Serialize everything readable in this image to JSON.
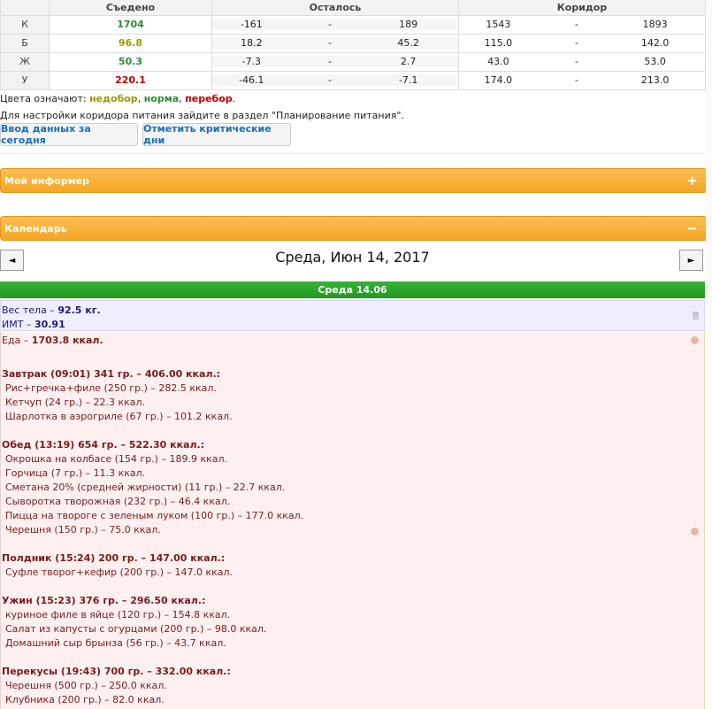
{
  "summary": {
    "headers": {
      "key": "",
      "eaten": "Съедено",
      "remaining": "Осталось",
      "corridor": "Коридор"
    },
    "rows": [
      {
        "key": "К",
        "eaten": "1704",
        "eaten_color": "#2e8b2e",
        "rem_from": "-161",
        "sep": "-",
        "rem_to": "189",
        "cor_from": "1543",
        "cor_sep": "-",
        "cor_to": "1893"
      },
      {
        "key": "Б",
        "eaten": "96.8",
        "eaten_color": "#9a9a00",
        "rem_from": "18.2",
        "sep": "-",
        "rem_to": "45.2",
        "cor_from": "115.0",
        "cor_sep": "-",
        "cor_to": "142.0"
      },
      {
        "key": "Ж",
        "eaten": "50.3",
        "eaten_color": "#2e8b2e",
        "rem_from": "-7.3",
        "sep": "-",
        "rem_to": "2.7",
        "cor_from": "43.0",
        "cor_sep": "-",
        "cor_to": "53.0"
      },
      {
        "key": "У",
        "eaten": "220.1",
        "eaten_color": "#c00000",
        "rem_from": "-46.1",
        "sep": "-",
        "rem_to": "-7.1",
        "cor_from": "174.0",
        "cor_sep": "-",
        "cor_to": "213.0"
      }
    ]
  },
  "legend": {
    "prefix": "Цвета означают: ",
    "under": "недобор",
    "comma1": ", ",
    "norm": "норма",
    "comma2": ", ",
    "over": "перебор",
    "end": "."
  },
  "hint": "Для настройки коридора питания зайдите в раздел \"Планирование питания\".",
  "buttons": {
    "today": "Ввод данных за сегодня",
    "critical": "Отметить критические дни"
  },
  "informer": {
    "title": "Мой информер",
    "toggle": "+"
  },
  "calendar": {
    "title": "Календарь",
    "toggle": "−",
    "prev": "◄",
    "next": "►",
    "date": "Среда, Июн 14, 2017",
    "day_label": "Среда 14.06"
  },
  "body": {
    "weight_label": "Вес тела – ",
    "weight_value": "92.5 кг.",
    "bmi_label": "ИМТ – ",
    "bmi_value": "30.91"
  },
  "food": {
    "total_label": "Еда – ",
    "total_value": "1703.8 ккал.",
    "lines": [
      {
        "type": "meal",
        "text": "Завтрак (09:01) 341 гр. – 406.00 ккал.:"
      },
      {
        "type": "item",
        "text": "Рис+гречка+филе (250 гр.) – 282.5 ккал."
      },
      {
        "type": "item",
        "text": "Кетчуп (24 гр.) – 22.3 ккал."
      },
      {
        "type": "item",
        "text": "Шарлотка в аэрогриле (67 гр.) – 101.2 ккал."
      },
      {
        "type": "meal",
        "text": "Обед (13:19) 654 гр. – 522.30 ккал.:"
      },
      {
        "type": "item",
        "text": "Окрошка на колбасе (154 гр.) – 189.9 ккал."
      },
      {
        "type": "item",
        "text": "Горчица (7 гр.) – 11.3 ккал."
      },
      {
        "type": "item",
        "text": "Сметана 20% (средней жирности) (11 гр.) – 22.7 ккал."
      },
      {
        "type": "item",
        "text": "Сыворотка творожная (232 гр.) – 46.4 ккал."
      },
      {
        "type": "item",
        "text": "Пицца на твороге с зеленым луком (100 гр.) – 177.0 ккал."
      },
      {
        "type": "item",
        "text": "Черешня (150 гр.) – 75.0 ккал."
      },
      {
        "type": "meal",
        "text": "Полдник (15:24) 200 гр. – 147.00 ккал.:"
      },
      {
        "type": "item",
        "text": "Суфле творог+кефир (200 гр.) – 147.0 ккал."
      },
      {
        "type": "meal",
        "text": "Ужин (15:23) 376 гр. – 296.50 ккал.:"
      },
      {
        "type": "item",
        "text": "куриное филе в яйце (120 гр.) – 154.8 ккал."
      },
      {
        "type": "item",
        "text": "Салат из капусты с огурцами (200 гр.) – 98.0 ккал."
      },
      {
        "type": "item",
        "text": "Домашний сыр брынза (56 гр.) – 43.7 ккал."
      },
      {
        "type": "meal",
        "text": "Перекусы (19:43) 700 гр. – 332.00 ккал.:"
      },
      {
        "type": "item",
        "text": "Черешня (500 гр.) – 250.0 ккал."
      },
      {
        "type": "item",
        "text": "Клубника (200 гр.) – 82.0 ккал."
      }
    ]
  }
}
